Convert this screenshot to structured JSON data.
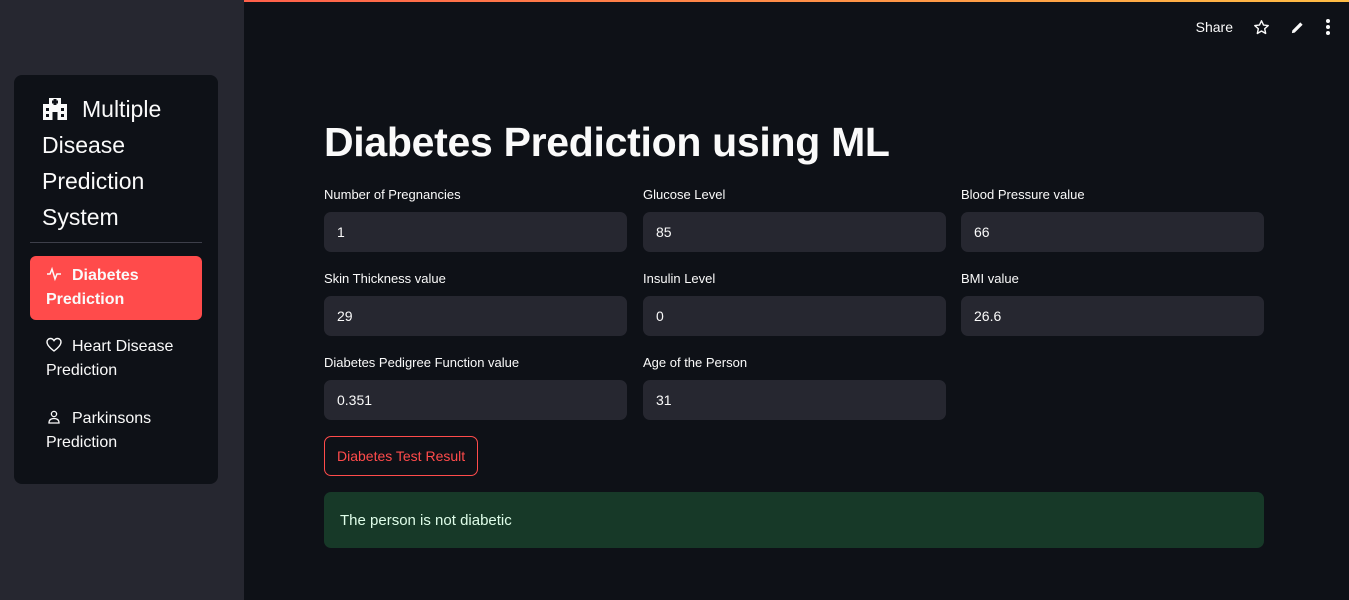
{
  "colors": {
    "accent": "#ff4b4b",
    "background": "#0e1117",
    "sidebar": "#262730",
    "success_bg": "#173928",
    "success_text": "#dffde9"
  },
  "sidebar": {
    "title": "Multiple Disease Prediction System",
    "title_icon": "hospital-icon",
    "items": [
      {
        "label": "Diabetes Prediction",
        "icon": "activity-icon",
        "active": true
      },
      {
        "label": "Heart Disease Prediction",
        "icon": "heart-icon",
        "active": false
      },
      {
        "label": "Parkinsons Prediction",
        "icon": "person-icon",
        "active": false
      }
    ]
  },
  "toolbar": {
    "share_label": "Share"
  },
  "main": {
    "title": "Diabetes Prediction using ML",
    "fields": [
      {
        "label": "Number of Pregnancies",
        "value": "1"
      },
      {
        "label": "Glucose Level",
        "value": "85"
      },
      {
        "label": "Blood Pressure value",
        "value": "66"
      },
      {
        "label": "Skin Thickness value",
        "value": "29"
      },
      {
        "label": "Insulin Level",
        "value": "0"
      },
      {
        "label": "BMI value",
        "value": "26.6"
      },
      {
        "label": "Diabetes Pedigree Function value",
        "value": "0.351"
      },
      {
        "label": "Age of the Person",
        "value": "31"
      }
    ],
    "button_label": "Diabetes Test Result",
    "result_text": "The person is not diabetic"
  }
}
